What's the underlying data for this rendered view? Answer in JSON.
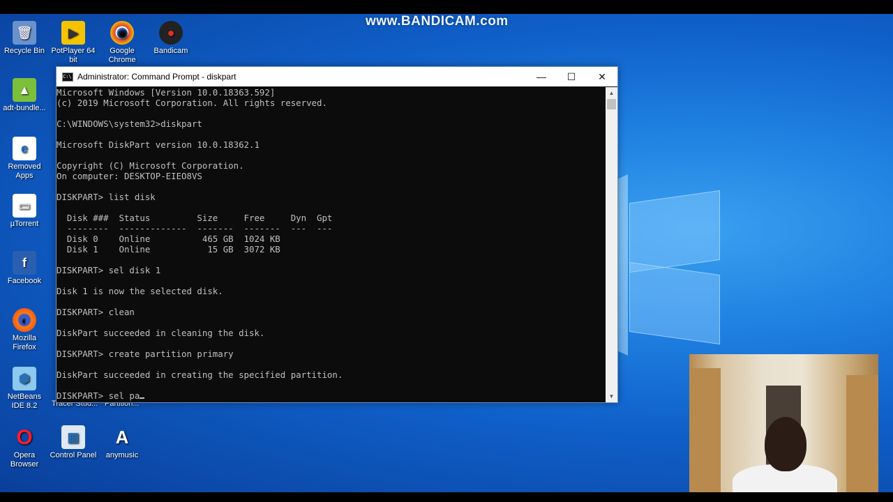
{
  "watermark": "www.BANDICAM.com",
  "desktop_icons": [
    {
      "label": "Recycle Bin",
      "glyph": "🗑"
    },
    {
      "label": "PotPlayer 64 bit",
      "glyph": "▶"
    },
    {
      "label": "Google Chrome",
      "glyph": "◉"
    },
    {
      "label": "Bandicam",
      "glyph": "●"
    },
    {
      "label": "adt-bundle...",
      "glyph": "▲"
    },
    {
      "label": "Removed Apps",
      "glyph": "e"
    },
    {
      "label": "µTorrent",
      "glyph": "▭"
    },
    {
      "label": "Facebook",
      "glyph": "f"
    },
    {
      "label": "Mozilla Firefox",
      "glyph": "◐"
    },
    {
      "label": "NetBeans IDE 8.2",
      "glyph": "⬢"
    },
    {
      "label": "Opera Browser",
      "glyph": "O"
    },
    {
      "label": "Control Panel",
      "glyph": "▦"
    },
    {
      "label": "anymusic",
      "glyph": "A"
    }
  ],
  "partial_labels": [
    "Tracer Stud...",
    "Partition..."
  ],
  "window": {
    "title": "Administrator: Command Prompt - diskpart",
    "icon_text": "C:\\",
    "minimize": "—",
    "maximize": "☐",
    "close": "✕"
  },
  "terminal": {
    "lines": [
      "Microsoft Windows [Version 10.0.18363.592]",
      "(c) 2019 Microsoft Corporation. All rights reserved.",
      "",
      "C:\\WINDOWS\\system32>diskpart",
      "",
      "Microsoft DiskPart version 10.0.18362.1",
      "",
      "Copyright (C) Microsoft Corporation.",
      "On computer: DESKTOP-EIEO8VS",
      "",
      "DISKPART> list disk",
      "",
      "  Disk ###  Status         Size     Free     Dyn  Gpt",
      "  --------  -------------  -------  -------  ---  ---",
      "  Disk 0    Online          465 GB  1024 KB",
      "  Disk 1    Online           15 GB  3072 KB",
      "",
      "DISKPART> sel disk 1",
      "",
      "Disk 1 is now the selected disk.",
      "",
      "DISKPART> clean",
      "",
      "DiskPart succeeded in cleaning the disk.",
      "",
      "DISKPART> create partition primary",
      "",
      "DiskPart succeeded in creating the specified partition.",
      ""
    ],
    "current_input": "DISKPART> sel pa"
  },
  "colors": {
    "terminal_bg": "#0c0c0c",
    "terminal_fg": "#c0c0c0",
    "desktop": "#1e7fe0"
  }
}
